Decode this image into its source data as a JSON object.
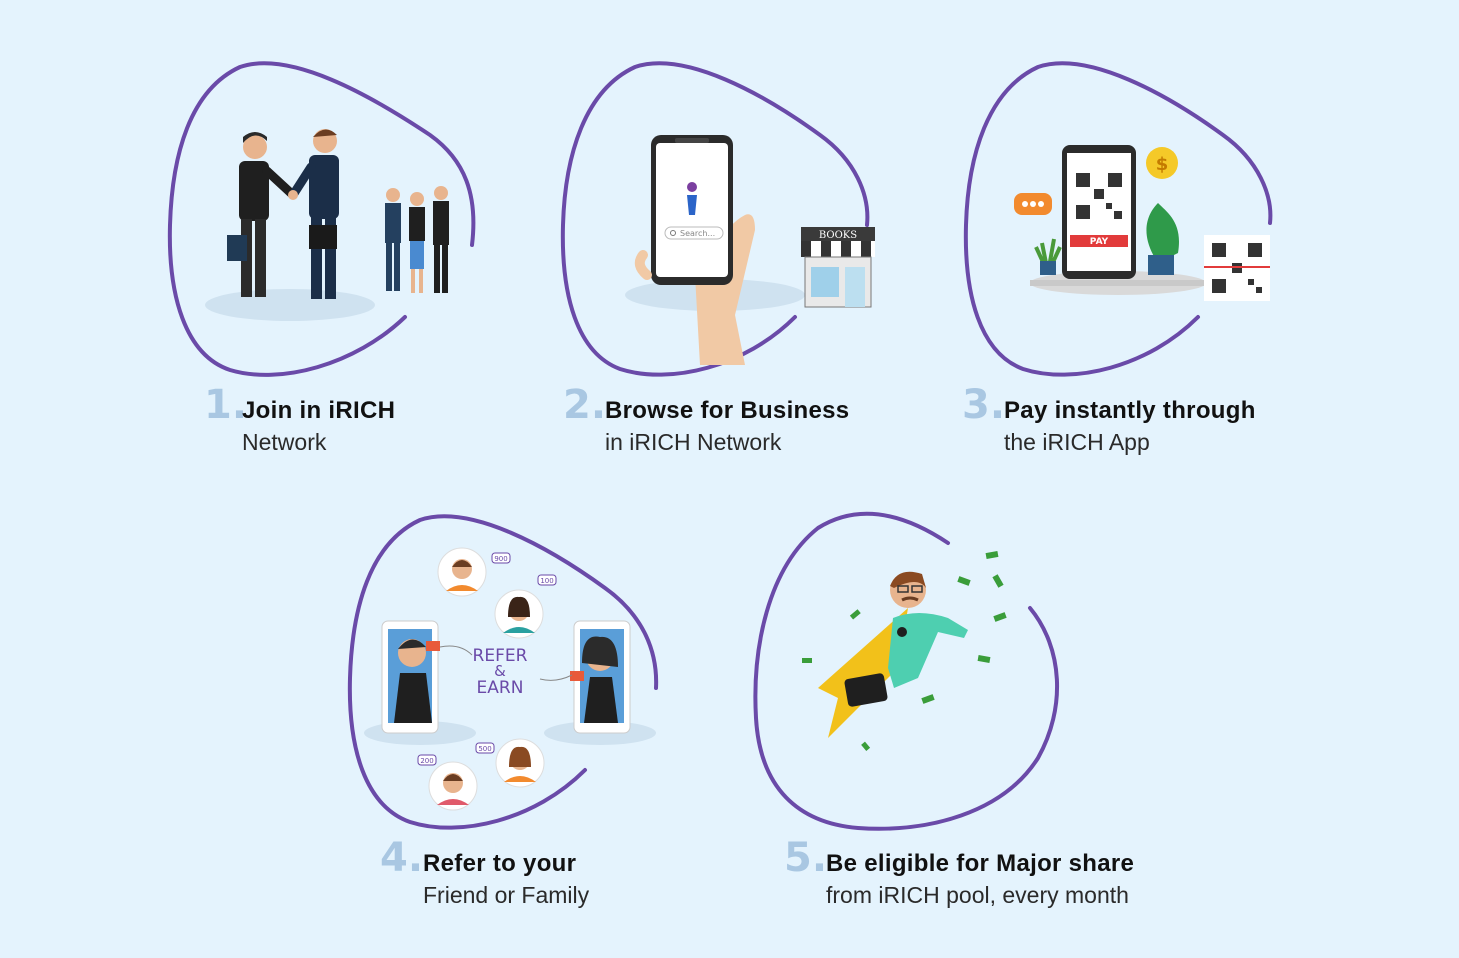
{
  "steps": [
    {
      "number": "1.",
      "title": "Join in iRICH",
      "subtitle": "Network"
    },
    {
      "number": "2.",
      "title": "Browse for Business",
      "subtitle": "in iRICH Network"
    },
    {
      "number": "3.",
      "title": "Pay instantly through",
      "subtitle": "the iRICH App"
    },
    {
      "number": "4.",
      "title": "Refer to your",
      "subtitle": "Friend or Family"
    },
    {
      "number": "5.",
      "title": "Be eligible for Major share",
      "subtitle": "from iRICH pool, every month"
    }
  ],
  "illustrations": {
    "store_sign": "BOOKS",
    "search_placeholder": "Search...",
    "pay_label": "PAY",
    "refer_line1": "REFER",
    "refer_line2": "&",
    "refer_line3": "EARN",
    "referral_points": [
      "900",
      "100",
      "200",
      "500"
    ]
  },
  "colors": {
    "background": "#e4f3fd",
    "frame_stroke": "#6a4aa8",
    "step_number": "#a9c7e2",
    "pay_red": "#e23b3b",
    "money_green": "#3a9d3a"
  }
}
